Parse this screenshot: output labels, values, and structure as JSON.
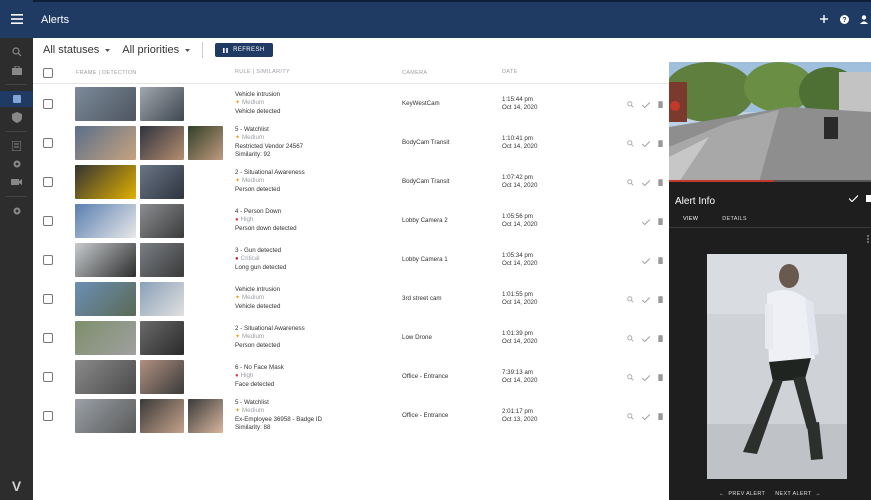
{
  "app": {
    "title": "Alerts",
    "logo": "V"
  },
  "icons": {
    "menu": "menu-icon",
    "search": "search-icon",
    "briefcase": "briefcase-icon",
    "shield": "shield-icon",
    "add": "plus-icon",
    "help": "help-icon",
    "user": "user-icon"
  },
  "colors": {
    "brand": "#1f3a63",
    "rail": "#2d2d2d",
    "panel": "#1e1e1e",
    "medium": "#f0a020",
    "high": "#e04040",
    "critical": "#c02020"
  },
  "filters": {
    "status": "All statuses",
    "priority": "All priorities",
    "refresh": "REFRESH"
  },
  "table": {
    "headers": {
      "frame": "FRAME | DETECTION",
      "rule": "RULE | SIMILARITY",
      "camera": "CAMERA",
      "date": "DATE"
    },
    "rows": [
      {
        "rule": "Vehicle intrusion",
        "severity": "Medium",
        "sev_level": "med",
        "detail": "Vehicle detected",
        "similarity": "",
        "camera": "KeyWestCam",
        "time": "1:15:44 pm",
        "date": "Oct 14, 2020",
        "actions": [
          "search",
          "check",
          "delete"
        ]
      },
      {
        "rule": "5 - Watchlist",
        "severity": "Medium",
        "sev_level": "med",
        "detail": "Restricted Vendor 24567",
        "similarity": "Similarity: 92",
        "camera": "BodyCam Transit",
        "time": "1:10:41 pm",
        "date": "Oct 14, 2020",
        "actions": [
          "search",
          "check",
          "delete"
        ]
      },
      {
        "rule": "2 - Situational Awareness",
        "severity": "Medium",
        "sev_level": "med",
        "detail": "Person detected",
        "similarity": "",
        "camera": "BodyCam Transit",
        "time": "1:07:42 pm",
        "date": "Oct 14, 2020",
        "actions": [
          "search",
          "check",
          "delete"
        ]
      },
      {
        "rule": "4 - Person Down",
        "severity": "High",
        "sev_level": "high",
        "detail": "Person down detected",
        "similarity": "",
        "camera": "Lobby Camera 2",
        "time": "1:05:56 pm",
        "date": "Oct 14, 2020",
        "actions": [
          "check",
          "delete"
        ]
      },
      {
        "rule": "3 - Gun detected",
        "severity": "Critical",
        "sev_level": "crit",
        "detail": "Long gun detected",
        "similarity": "",
        "camera": "Lobby Camera 1",
        "time": "1:05:34 pm",
        "date": "Oct 14, 2020",
        "actions": [
          "check",
          "delete"
        ]
      },
      {
        "rule": "Vehicle intrusion",
        "severity": "Medium",
        "sev_level": "med",
        "detail": "Vehicle detected",
        "similarity": "",
        "camera": "3rd street cam",
        "time": "1:01:55 pm",
        "date": "Oct 14, 2020",
        "actions": [
          "search",
          "check",
          "delete"
        ]
      },
      {
        "rule": "2 - Situational Awareness",
        "severity": "Medium",
        "sev_level": "med",
        "detail": "Person detected",
        "similarity": "",
        "camera": "Low Drone",
        "time": "1:01:39 pm",
        "date": "Oct 14, 2020",
        "actions": [
          "search",
          "check",
          "delete"
        ]
      },
      {
        "rule": "6 - No Face Mask",
        "severity": "High",
        "sev_level": "high",
        "detail": "Face detected",
        "similarity": "",
        "camera": "Office - Entrance",
        "time": "7:39:13 am",
        "date": "Oct 14, 2020",
        "actions": [
          "search",
          "check",
          "delete"
        ]
      },
      {
        "rule": "5 - Watchlist",
        "severity": "Medium",
        "sev_level": "med",
        "detail": "Ex-Employee 36958 - Badge ID",
        "similarity": "Similarity: 88",
        "camera": "Office - Entrance",
        "time": "2:01:17 pm",
        "date": "Oct 13, 2020",
        "actions": [
          "search",
          "check",
          "delete"
        ]
      }
    ]
  },
  "panel": {
    "title": "Alert Info",
    "tabs": [
      "VIEW",
      "DETAILS"
    ],
    "prev": "PREV ALERT",
    "next": "NEXT ALERT",
    "video_progress": 0.52
  }
}
